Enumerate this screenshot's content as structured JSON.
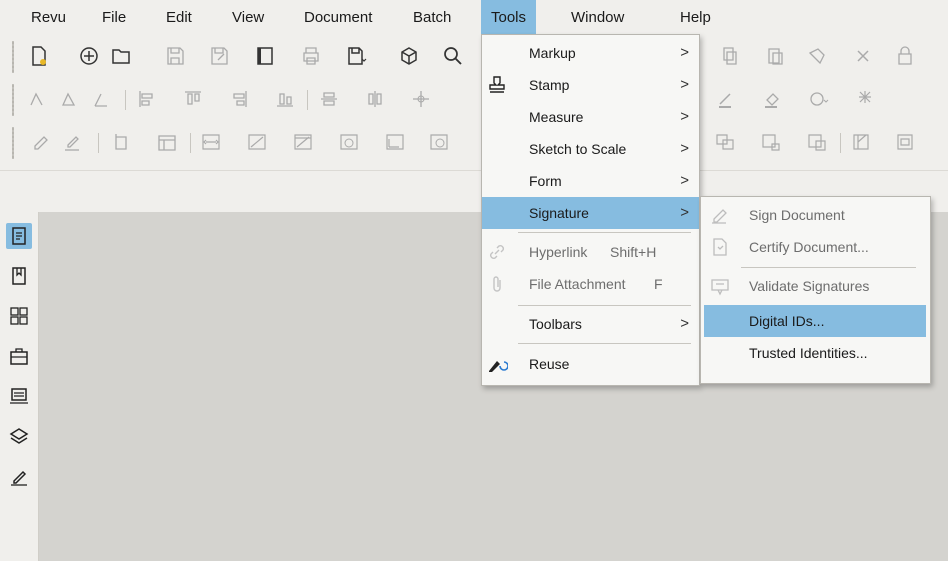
{
  "menubar": {
    "items": [
      {
        "label": "Revu"
      },
      {
        "label": "File"
      },
      {
        "label": "Edit"
      },
      {
        "label": "View"
      },
      {
        "label": "Document"
      },
      {
        "label": "Batch"
      },
      {
        "label": "Tools"
      },
      {
        "label": "Window"
      },
      {
        "label": "Help"
      }
    ],
    "active": "Tools"
  },
  "tools_menu": {
    "items": [
      {
        "label": "Markup",
        "submenu": true
      },
      {
        "label": "Stamp",
        "submenu": true,
        "icon": "stamp-icon"
      },
      {
        "label": "Measure",
        "submenu": true
      },
      {
        "label": "Sketch to Scale",
        "submenu": true
      },
      {
        "label": "Form",
        "submenu": true
      },
      {
        "label": "Signature",
        "submenu": true,
        "highlighted": true
      },
      {
        "label": "Hyperlink",
        "shortcut": "Shift+H",
        "disabled": true,
        "icon": "link-icon"
      },
      {
        "label": "File Attachment",
        "shortcut": "F",
        "disabled": true,
        "icon": "paperclip-icon"
      },
      {
        "label": "Toolbars",
        "submenu": true
      },
      {
        "label": "Reuse",
        "icon": "reuse-icon"
      }
    ],
    "arrow": ">"
  },
  "signature_menu": {
    "items": [
      {
        "label": "Sign Document",
        "disabled": true,
        "icon": "sign-pen-icon"
      },
      {
        "label": "Certify Document...",
        "disabled": true,
        "icon": "certify-icon"
      },
      {
        "label": "Validate Signatures",
        "disabled": true,
        "icon": "validate-icon"
      },
      {
        "label": "Digital IDs...",
        "highlighted": true
      },
      {
        "label": "Trusted Identities..."
      }
    ]
  },
  "sidebar": {
    "icons": [
      "properties-icon",
      "bookmarks-icon",
      "thumbnails-icon",
      "toolchest-icon",
      "studio-icon",
      "layers-icon",
      "signatures-icon"
    ],
    "selected": "properties-icon"
  },
  "colors": {
    "highlight": "#86bce0",
    "chrome": "#f0efec",
    "workspace": "#d4d3cf"
  }
}
